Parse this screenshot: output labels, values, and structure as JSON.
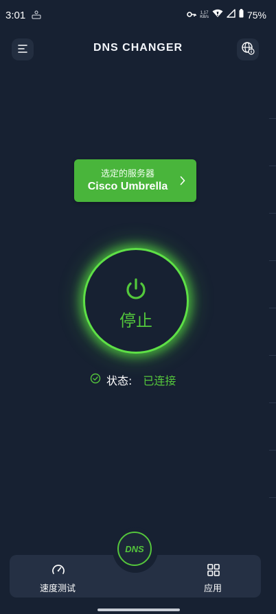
{
  "status_bar": {
    "time": "3:01",
    "speed_value": "1.17",
    "speed_unit": "KB/s",
    "battery": "75%"
  },
  "header": {
    "title": "DNS CHANGER",
    "menu_icon": "menu-icon",
    "language_icon": "globe-info-icon"
  },
  "server": {
    "label": "选定的服务器",
    "name": "Cisco Umbrella"
  },
  "power": {
    "label": "停止",
    "icon": "power-icon"
  },
  "status": {
    "label": "状态:",
    "value": "已连接"
  },
  "bottom_nav": {
    "speed_test_label": "速度测试",
    "apps_label": "应用",
    "dns_button": "DNS"
  },
  "colors": {
    "background": "#172132",
    "accent_green": "#49b53b",
    "glow_green": "#5ee046",
    "card": "#253044"
  }
}
